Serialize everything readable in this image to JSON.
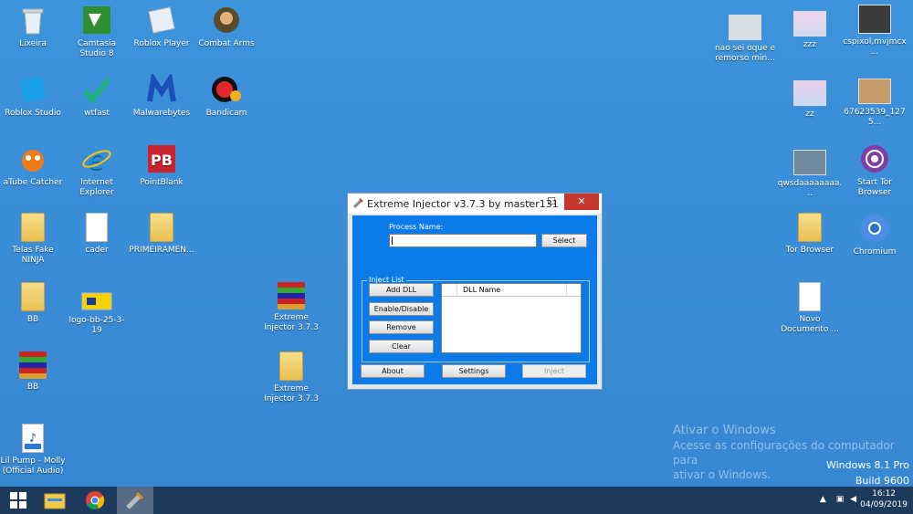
{
  "desktop_icons": {
    "lixeira": "Lixeira",
    "camtasia": "Camtasia Studio 8",
    "roblox_player": "Roblox Player",
    "combat_arms": "Combat Arms",
    "roblox_studio": "Roblox Studio",
    "wtfast": "wtfast",
    "malwarebytes": "Malwarebytes",
    "bandicam": "Bandicam",
    "atube": "aTube Catcher",
    "ie": "Internet Explorer",
    "pointblank": "PointBlank",
    "telas": "Telas Fake NINJA",
    "cader": "cader",
    "primeiramen": "PRIMEIRAMEN...",
    "bb1": "BB",
    "logo_bb": "logo-bb-25-3-19",
    "ext_inj_rar": "Extreme Injector 3.7.3",
    "bb2": "BB",
    "ext_inj_folder": "Extreme Injector 3.7.3",
    "lil_pump": "Lil Pump - Molly (Official Audio)",
    "nao_sei": "nao sei oque e remorso min...",
    "zzz": "zzz",
    "cspixol": "cspixol,mvjmcx...",
    "zz": "zz",
    "n67623539": "67623539_1275...",
    "qwsda": "qwsdaaaaaaaa...",
    "start_tor": "Start Tor Browser",
    "tor_browser": "Tor Browser",
    "chromium": "Chromium",
    "novo_documento": "Novo Documento ..."
  },
  "injector": {
    "title": "Extreme Injector v3.7.3 by master131",
    "minimize": "–",
    "maximize": "☐",
    "close": "✕",
    "process_label": "Process Name:",
    "process_value": "",
    "select": "Select",
    "inject_list_label": "Inject List",
    "add_dll": "Add DLL",
    "enable_disable": "Enable/Disable",
    "remove": "Remove",
    "clear": "Clear",
    "dll_name_header": "DLL Name",
    "about": "About",
    "settings": "Settings",
    "inject": "Inject"
  },
  "watermark": {
    "title": "Ativar o Windows",
    "line1": "Acesse as configurações do computador para",
    "line2": "ativar o Windows."
  },
  "windows_version": {
    "line1": "Windows 8.1 Pro",
    "line2": "Build 9600"
  },
  "taskbar": {
    "time": "16:12",
    "date": "04/09/2019",
    "tray_arrow": "▲",
    "start_icon": "windows-start-icon",
    "colors": {
      "taskbar": "#1d3a5c",
      "desktop": "#3a8ed6",
      "injector_client": "#0a7be8",
      "close": "#c7372f"
    }
  }
}
